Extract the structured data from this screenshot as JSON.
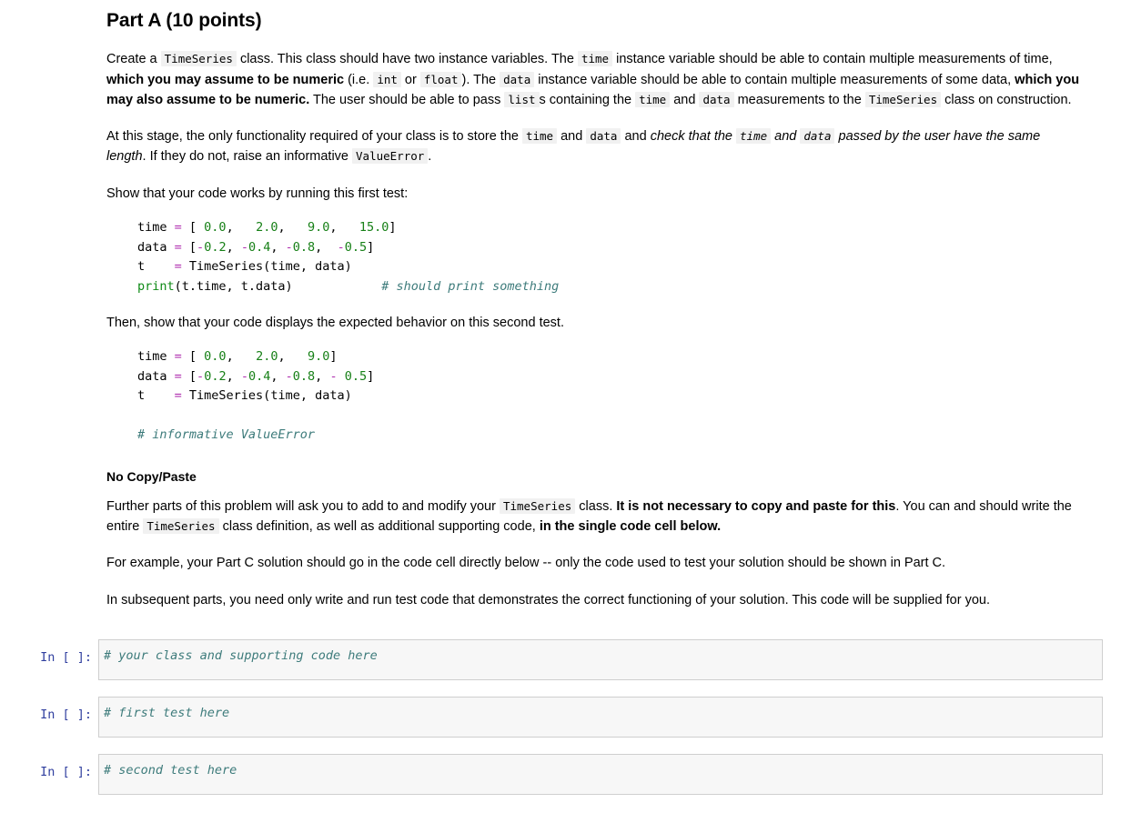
{
  "document": {
    "heading": "Part A (10 points)",
    "subheading": "No Copy/Paste"
  },
  "paragraph1": {
    "s1": "Create a ",
    "c1": "TimeSeries",
    "s2": " class. This class should have two instance variables. The ",
    "c2": "time",
    "s3": " instance variable should be able to contain multiple measurements of time,",
    "b1": " which you may assume to be numeric",
    "s4": " (i.e. ",
    "c3": "int",
    "s5": " or ",
    "c4": "float",
    "s6": "). The ",
    "c5": "data",
    "s7": " instance variable should be able to contain multiple measurements of some data,",
    "b2": " which you may also assume to be numeric.",
    "s8": " The user should be able to pass ",
    "c6": "list",
    "s9": "s containing the ",
    "c7": "time",
    "s10": " and ",
    "c8": "data",
    "s11": " measurements to the ",
    "c9": "TimeSeries",
    "s12": " class on construction."
  },
  "paragraph2": {
    "s1": "At this stage, the only functionality required of your class is to store the ",
    "c1": "time",
    "s2": " and ",
    "c2": "data",
    "s3": " and ",
    "i1": "check that the ",
    "ci1": "time",
    "i2": " and ",
    "ci2": "data",
    "i3": " passed by the user have the same length",
    "s4": ". If they do not, raise an informative ",
    "c3": "ValueError",
    "s5": "."
  },
  "paragraph3": {
    "text": "Show that your code works by running this first test:"
  },
  "code_block_1": {
    "lines": [
      [
        {
          "t": "time ",
          "k": "plain"
        },
        {
          "t": "=",
          "k": "op"
        },
        {
          "t": " [ ",
          "k": "plain"
        },
        {
          "t": "0.0",
          "k": "num"
        },
        {
          "t": ",   ",
          "k": "plain"
        },
        {
          "t": "2.0",
          "k": "num"
        },
        {
          "t": ",   ",
          "k": "plain"
        },
        {
          "t": "9.0",
          "k": "num"
        },
        {
          "t": ",   ",
          "k": "plain"
        },
        {
          "t": "15.0",
          "k": "num"
        },
        {
          "t": "]",
          "k": "plain"
        }
      ],
      [
        {
          "t": "data ",
          "k": "plain"
        },
        {
          "t": "=",
          "k": "op"
        },
        {
          "t": " [",
          "k": "plain"
        },
        {
          "t": "-",
          "k": "op"
        },
        {
          "t": "0.2",
          "k": "num"
        },
        {
          "t": ", ",
          "k": "plain"
        },
        {
          "t": "-",
          "k": "op"
        },
        {
          "t": "0.4",
          "k": "num"
        },
        {
          "t": ", ",
          "k": "plain"
        },
        {
          "t": "-",
          "k": "op"
        },
        {
          "t": "0.8",
          "k": "num"
        },
        {
          "t": ",  ",
          "k": "plain"
        },
        {
          "t": "-",
          "k": "op"
        },
        {
          "t": "0.5",
          "k": "num"
        },
        {
          "t": "]",
          "k": "plain"
        }
      ],
      [
        {
          "t": "t    ",
          "k": "plain"
        },
        {
          "t": "=",
          "k": "op"
        },
        {
          "t": " TimeSeries(time, data)",
          "k": "plain"
        }
      ],
      [
        {
          "t": "print",
          "k": "fn"
        },
        {
          "t": "(t.time, t.data)",
          "k": "plain"
        },
        {
          "t": "            ",
          "k": "plain"
        },
        {
          "t": "# should print something",
          "k": "com"
        }
      ]
    ]
  },
  "paragraph4": {
    "text": "Then, show that your code displays the expected behavior on this second test."
  },
  "code_block_2": {
    "lines": [
      [
        {
          "t": "time ",
          "k": "plain"
        },
        {
          "t": "=",
          "k": "op"
        },
        {
          "t": " [ ",
          "k": "plain"
        },
        {
          "t": "0.0",
          "k": "num"
        },
        {
          "t": ",   ",
          "k": "plain"
        },
        {
          "t": "2.0",
          "k": "num"
        },
        {
          "t": ",   ",
          "k": "plain"
        },
        {
          "t": "9.0",
          "k": "num"
        },
        {
          "t": "]",
          "k": "plain"
        }
      ],
      [
        {
          "t": "data ",
          "k": "plain"
        },
        {
          "t": "=",
          "k": "op"
        },
        {
          "t": " [",
          "k": "plain"
        },
        {
          "t": "-",
          "k": "op"
        },
        {
          "t": "0.2",
          "k": "num"
        },
        {
          "t": ", ",
          "k": "plain"
        },
        {
          "t": "-",
          "k": "op"
        },
        {
          "t": "0.4",
          "k": "num"
        },
        {
          "t": ", ",
          "k": "plain"
        },
        {
          "t": "-",
          "k": "op"
        },
        {
          "t": "0.8",
          "k": "num"
        },
        {
          "t": ", ",
          "k": "plain"
        },
        {
          "t": "-",
          "k": "op"
        },
        {
          "t": " ",
          "k": "plain"
        },
        {
          "t": "0.5",
          "k": "num"
        },
        {
          "t": "]",
          "k": "plain"
        }
      ],
      [
        {
          "t": "t    ",
          "k": "plain"
        },
        {
          "t": "=",
          "k": "op"
        },
        {
          "t": " TimeSeries(time, data)",
          "k": "plain"
        }
      ],
      [
        {
          "t": "",
          "k": "plain"
        }
      ],
      [
        {
          "t": "# informative ValueError",
          "k": "com"
        }
      ]
    ]
  },
  "paragraph5": {
    "s1": "Further parts of this problem will ask you to add to and modify your ",
    "c1": "TimeSeries",
    "s2": " class. ",
    "b1": "It is not necessary to copy and paste for this",
    "s3": ". You can and should write the entire ",
    "c2": "TimeSeries",
    "s4": " class definition, as well as additional supporting code, ",
    "b2": "in the single code cell below."
  },
  "paragraph6": {
    "text": "For example, your Part C solution should go in the code cell directly below -- only the code used to test your solution should be shown in Part C."
  },
  "paragraph7": {
    "text": "In subsequent parts, you need only write and run test code that demonstrates the correct functioning of your solution. This code will be supplied for you."
  },
  "cells": [
    {
      "prompt": "In [ ]:",
      "code": "# your class and supporting code here"
    },
    {
      "prompt": "In [ ]:",
      "code": "# first test here"
    },
    {
      "prompt": "In [ ]:",
      "code": "# second test here"
    }
  ],
  "colors": {
    "operator": "#b030b0",
    "number": "#178017",
    "comment": "#3d7b7b",
    "prompt": "#303f9f",
    "cell_background": "#f7f7f7",
    "cell_border": "#cfcfcf",
    "inline_code_background": "#f1f1f1"
  }
}
